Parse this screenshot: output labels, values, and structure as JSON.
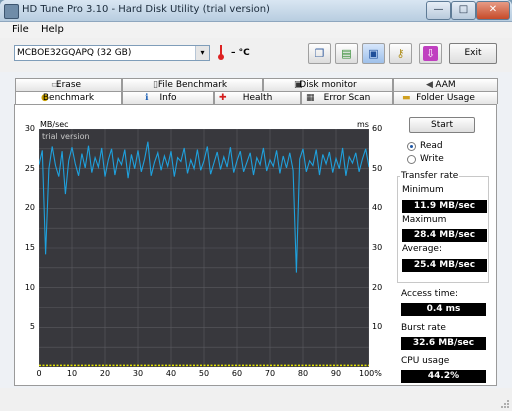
{
  "window": {
    "title": "HD Tune Pro 3.10 - Hard Disk Utility (trial version)"
  },
  "menu": [
    {
      "label": "File"
    },
    {
      "label": "Help"
    }
  ],
  "toolbar": {
    "drive": "MCBOE32GQAPQ (32 GB)",
    "temperature": "– °C",
    "exit_label": "Exit"
  },
  "tabs_top": [
    {
      "label": "Erase",
      "icon": "eraser-icon"
    },
    {
      "label": "File Benchmark",
      "icon": "file-icon"
    },
    {
      "label": "Disk monitor",
      "icon": "monitor-icon"
    },
    {
      "label": "AAM",
      "icon": "speaker-icon"
    }
  ],
  "tabs_bottom": [
    {
      "label": "Benchmark",
      "icon": "lightbulb-icon"
    },
    {
      "label": "Info",
      "icon": "info-icon"
    },
    {
      "label": "Health",
      "icon": "plus-icon"
    },
    {
      "label": "Error Scan",
      "icon": "scan-icon"
    },
    {
      "label": "Folder Usage",
      "icon": "folder-icon"
    }
  ],
  "benchmark": {
    "start_label": "Start",
    "mode_options": [
      "Read",
      "Write"
    ],
    "selected_mode": "Read",
    "transfer_rate_title": "Transfer rate",
    "minimum_label": "Minimum",
    "minimum_value": "11.9 MB/sec",
    "maximum_label": "Maximum",
    "maximum_value": "28.4 MB/sec",
    "average_label": "Average:",
    "average_value": "25.4 MB/sec",
    "access_time_label": "Access time:",
    "access_time_value": "0.4 ms",
    "burst_rate_label": "Burst rate",
    "burst_rate_value": "32.6 MB/sec",
    "cpu_usage_label": "CPU usage",
    "cpu_usage_value": "44.2%"
  },
  "chart_data": {
    "type": "line",
    "watermark": "trial version",
    "ylabel_left": "MB/sec",
    "ylabel_right": "ms",
    "xlabel": "",
    "left_ticks": [
      "30",
      "25",
      "20",
      "15",
      "10",
      "5"
    ],
    "right_ticks": [
      "60",
      "50",
      "40",
      "30",
      "20",
      "10"
    ],
    "x_ticks": [
      "0",
      "10",
      "20",
      "30",
      "40",
      "50",
      "60",
      "70",
      "80",
      "90",
      "100%"
    ],
    "ylim_left": [
      0,
      30
    ],
    "ylim_right": [
      0,
      60
    ],
    "xlim": [
      0,
      100
    ],
    "grid": true,
    "series": [
      {
        "color": "#1fa0dc",
        "x": [
          0,
          1,
          2,
          3,
          4,
          5,
          6,
          7,
          8,
          9,
          10,
          11,
          12,
          13,
          14,
          15,
          16,
          17,
          18,
          19,
          20,
          21,
          22,
          23,
          24,
          25,
          26,
          27,
          28,
          29,
          30,
          31,
          32,
          33,
          34,
          35,
          36,
          37,
          38,
          39,
          40,
          41,
          42,
          43,
          44,
          45,
          46,
          47,
          48,
          49,
          50,
          51,
          52,
          53,
          54,
          55,
          56,
          57,
          58,
          59,
          60,
          61,
          62,
          63,
          64,
          65,
          66,
          67,
          68,
          69,
          70,
          71,
          72,
          73,
          74,
          75,
          76,
          77,
          78,
          79,
          80,
          81,
          82,
          83,
          84,
          85,
          86,
          87,
          88,
          89,
          90,
          91,
          92,
          93,
          94,
          95,
          96,
          97,
          98,
          99,
          100
        ],
        "values": [
          25.5,
          27.3,
          14.2,
          25.0,
          27.8,
          25.4,
          24.0,
          27.2,
          21.8,
          26.0,
          27.7,
          25.6,
          24.1,
          26.9,
          25.1,
          27.9,
          24.5,
          26.4,
          25.2,
          27.6,
          24.0,
          26.1,
          27.5,
          24.2,
          26.3,
          25.5,
          27.4,
          23.8,
          26.8,
          25.0,
          27.3,
          24.6,
          26.2,
          28.4,
          24.1,
          25.8,
          27.0,
          24.8,
          26.6,
          25.3,
          27.2,
          24.0,
          26.4,
          25.9,
          27.6,
          24.4,
          26.1,
          25.0,
          27.4,
          24.8,
          26.0,
          27.8,
          24.3,
          25.7,
          27.1,
          24.9,
          26.5,
          25.2,
          27.7,
          24.5,
          26.0,
          27.2,
          24.6,
          25.8,
          27.0,
          24.2,
          26.4,
          25.5,
          27.6,
          24.7,
          26.1,
          25.3,
          27.3,
          24.4,
          26.6,
          25.1,
          27.0,
          24.8,
          11.9,
          26.2,
          27.5,
          24.6,
          26.0,
          25.4,
          27.4,
          24.2,
          26.8,
          25.6,
          27.1,
          24.5,
          26.3,
          25.0,
          27.6,
          24.1,
          26.5,
          25.7,
          27.0,
          24.6,
          26.2,
          27.5,
          25.2
        ]
      },
      {
        "color": "#e6e600",
        "axis": "right",
        "x": [
          0,
          10,
          20,
          30,
          40,
          50,
          60,
          70,
          80,
          90,
          100
        ],
        "values": [
          0.4,
          0.4,
          0.4,
          0.4,
          0.4,
          0.4,
          0.4,
          0.4,
          0.4,
          0.4,
          0.4
        ]
      }
    ]
  }
}
